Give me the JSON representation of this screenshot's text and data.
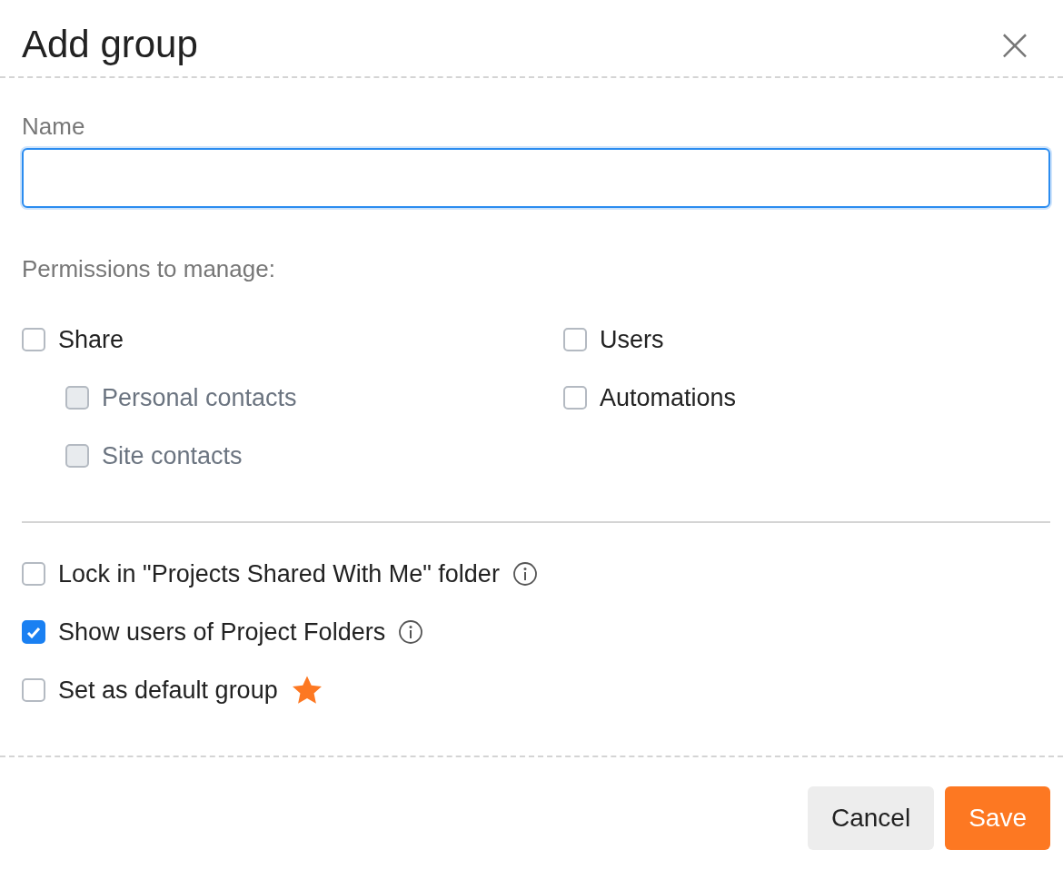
{
  "dialog": {
    "title": "Add group",
    "close": "×"
  },
  "name_field": {
    "label": "Name"
  },
  "permissions": {
    "label": "Permissions to manage:",
    "columns": [
      [
        {
          "label": "Share",
          "checked": false,
          "disabled": false,
          "children": [
            {
              "label": "Personal contacts",
              "checked": false,
              "disabled": true
            },
            {
              "label": "Site contacts",
              "checked": false,
              "disabled": true
            }
          ]
        }
      ],
      [
        {
          "label": "Users",
          "checked": false,
          "disabled": false
        },
        {
          "label": "Automations",
          "checked": false,
          "disabled": false
        }
      ]
    ]
  },
  "options": [
    {
      "label": "Lock in \"Projects Shared With Me\" folder",
      "checked": false,
      "kind": "info"
    },
    {
      "label": "Show users of Project Folders",
      "checked": true,
      "kind": "info"
    },
    {
      "label": "Set as default group",
      "checked": false,
      "kind": "star"
    }
  ],
  "buttons": [
    {
      "label": "Cancel",
      "kind": "secondary"
    },
    {
      "label": "Save",
      "kind": "primary"
    }
  ]
}
